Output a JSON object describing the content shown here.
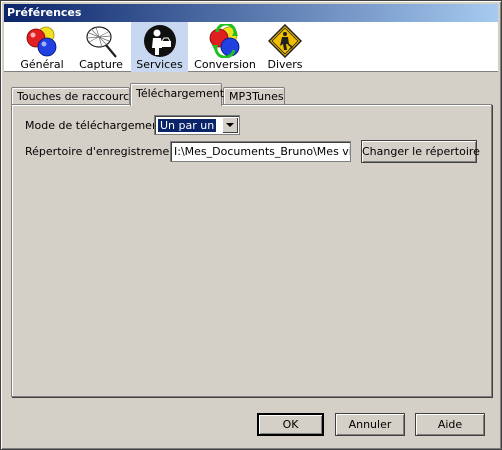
{
  "window": {
    "title": "Préférences"
  },
  "toolbar": {
    "items": [
      {
        "label": "Général",
        "icon": "general-icon"
      },
      {
        "label": "Capture",
        "icon": "capture-net-icon"
      },
      {
        "label": "Services",
        "icon": "services-icon",
        "active": true
      },
      {
        "label": "Conversion",
        "icon": "conversion-icon"
      },
      {
        "label": "Divers",
        "icon": "divers-icon"
      }
    ]
  },
  "tabs": [
    {
      "label": "Touches de raccourcis"
    },
    {
      "label": "Téléchargement",
      "active": true
    },
    {
      "label": "MP3Tunes"
    }
  ],
  "download": {
    "mode_label": "Mode de téléchargement",
    "mode_value": "Un par un",
    "dir_label": "Répertoire d'enregistrement",
    "dir_value": "I:\\Mes_Documents_Bruno\\Mes vidéo",
    "change_dir_button": "Changer le répertoire"
  },
  "buttons": {
    "ok": "OK",
    "cancel": "Annuler",
    "help": "Aide"
  },
  "colors": {
    "title_bar_start": "#0a246a",
    "title_bar_end": "#a6caf0",
    "selection": "#0a246a",
    "active_tool_bg": "#c8d8f0"
  }
}
